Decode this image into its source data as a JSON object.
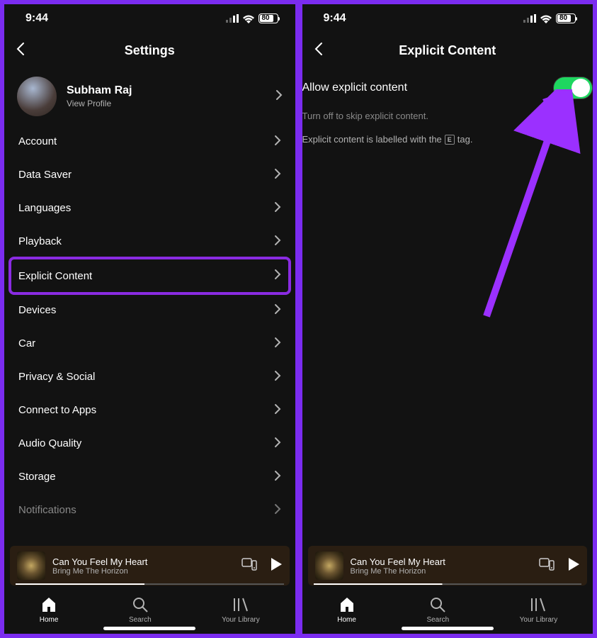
{
  "status": {
    "time": "9:44",
    "battery": "80"
  },
  "left": {
    "title": "Settings",
    "profile": {
      "name": "Subham Raj",
      "sub": "View Profile"
    },
    "items": [
      {
        "label": "Account"
      },
      {
        "label": "Data Saver"
      },
      {
        "label": "Languages"
      },
      {
        "label": "Playback"
      },
      {
        "label": "Explicit Content",
        "highlighted": true
      },
      {
        "label": "Devices"
      },
      {
        "label": "Car"
      },
      {
        "label": "Privacy & Social"
      },
      {
        "label": "Connect to Apps"
      },
      {
        "label": "Audio Quality"
      },
      {
        "label": "Storage"
      },
      {
        "label": "Notifications",
        "faded": true
      }
    ]
  },
  "right": {
    "title": "Explicit Content",
    "toggle_label": "Allow explicit content",
    "sub1": "Turn off to skip explicit content.",
    "sub2_pre": "Explicit content is labelled with the ",
    "sub2_tag": "E",
    "sub2_post": " tag."
  },
  "now_playing": {
    "title": "Can You Feel My Heart",
    "artist": "Bring Me The Horizon"
  },
  "tabs": {
    "home": "Home",
    "search": "Search",
    "library": "Your Library"
  }
}
